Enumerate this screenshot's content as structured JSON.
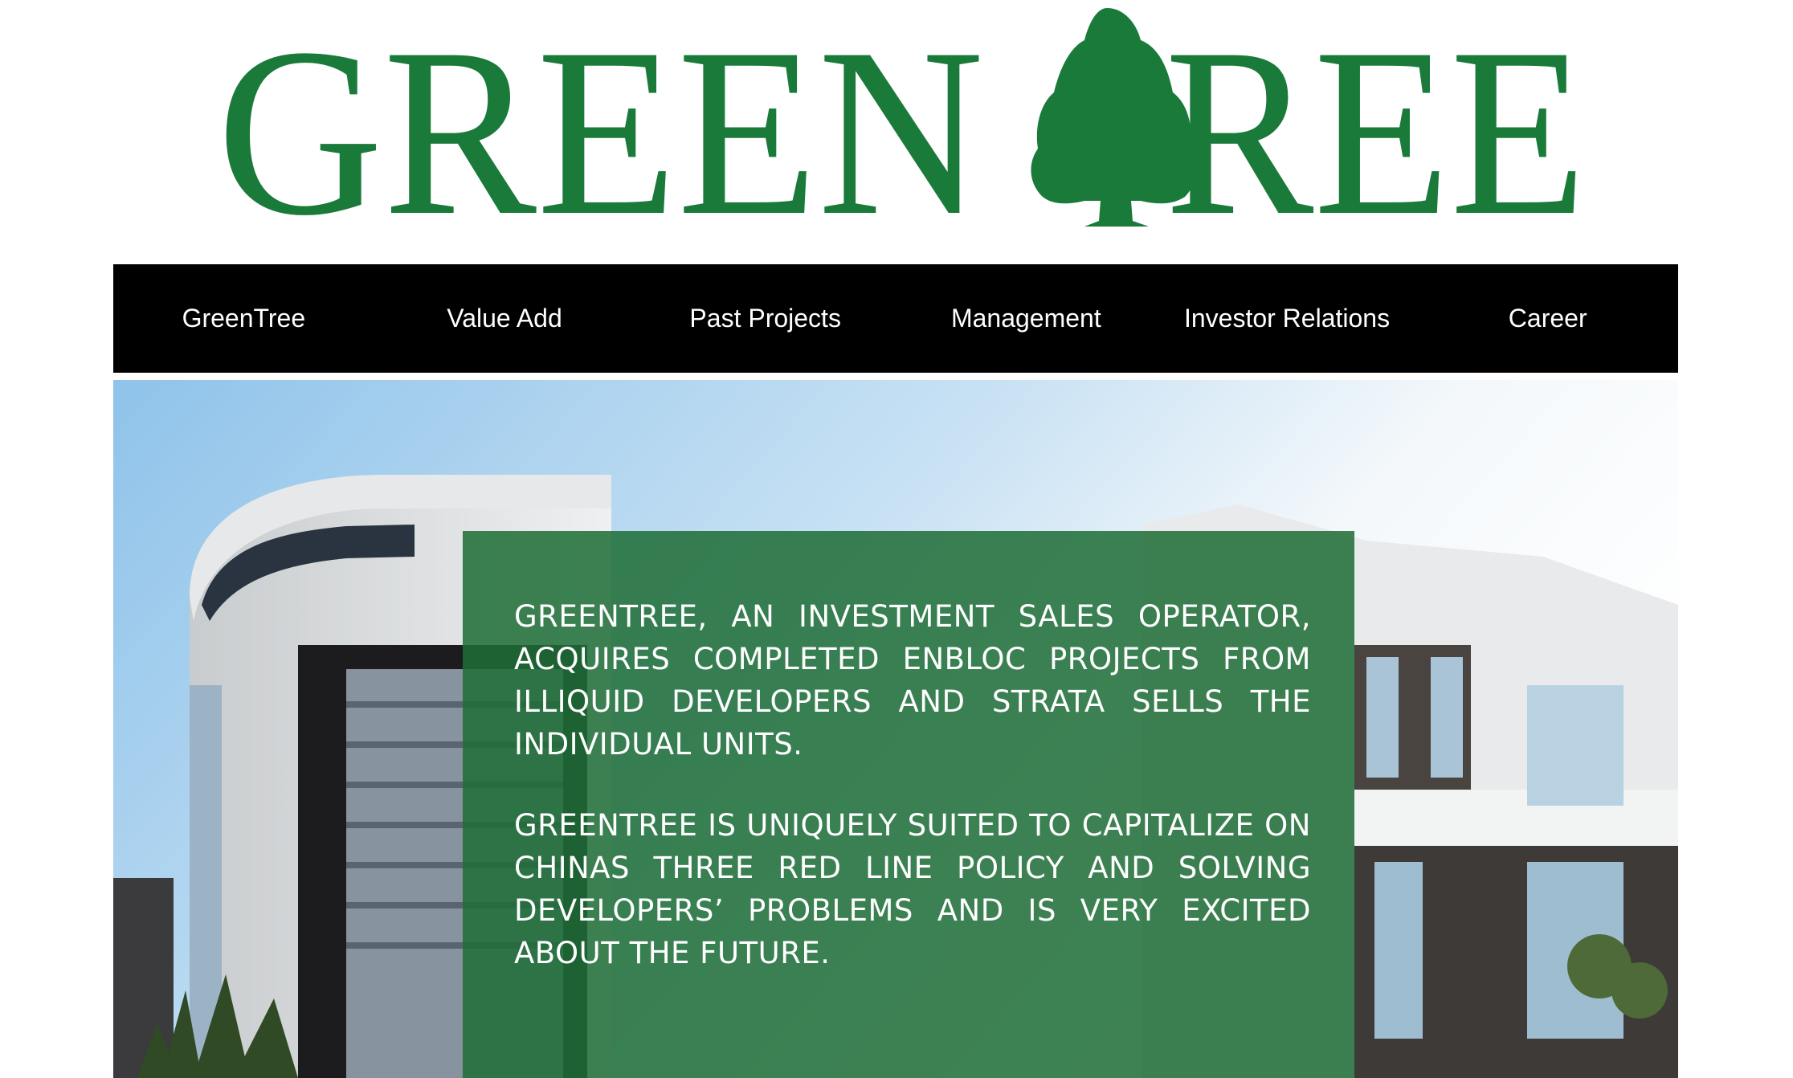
{
  "brand": {
    "logo_text_left": "GREEN",
    "logo_text_right": "REE",
    "logo_color": "#1a7a3a"
  },
  "nav": {
    "items": [
      {
        "label": "GreenTree"
      },
      {
        "label": "Value Add"
      },
      {
        "label": "Past Projects"
      },
      {
        "label": "Management"
      },
      {
        "label": "Investor Relations"
      },
      {
        "label": "Career"
      }
    ]
  },
  "hero": {
    "paragraph_1": "GREENTREE, AN INVESTMENT SALES OPERATOR, ACQUIRES COMPLETED ENBLOC PROJECTS FROM ILLIQUID DEVELOPERS AND STRATA SELLS THE INDIVIDUAL UNITS.",
    "paragraph_2": "GREENTREE IS UNIQUELY SUITED TO CAPITALIZE ON CHINAS THREE RED LINE POLICY AND SOLVING DEVELOPERS’ PROBLEMS AND IS VERY EXCITED ABOUT THE FUTURE.",
    "overlay_color": "#1e6e37"
  }
}
